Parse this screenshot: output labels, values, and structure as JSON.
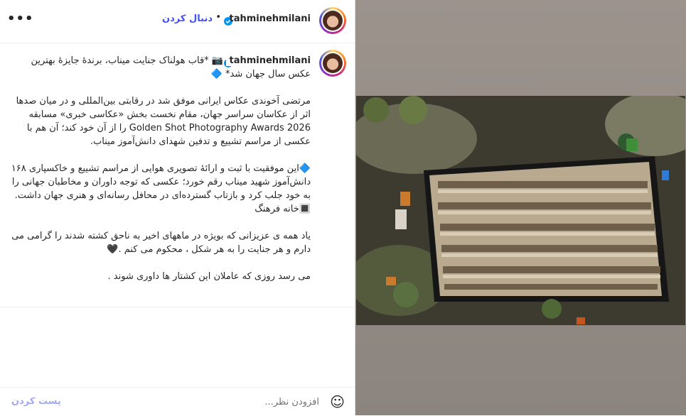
{
  "header": {
    "username": "tahminehmilani",
    "follow_label": "دنبال کردن",
    "separator": "•",
    "more_label": "•••"
  },
  "caption": {
    "username": "tahminehmilani",
    "paragraphs": [
      "*قاب هولناک جنایت میناب، برندهٔ جایزهٔ بهترین\nعکس سال جهان شد* 🔷",
      "مرتضی آخوندی عکاس ایرانی موفق شد در رقابتی بین‌المللی و در میان صدها اثر از عکاسان سراسر جهان، مقام نخست بخش «عکاسی خبری» مسابقه Golden Shot Photography Awards 2026 را از آن خود کند؛ آن هم با عکسی از مراسم تشییع و تدفین شهدای دانش‌آموز میناب.",
      "🔷این موفقیت با ثبت و ارائهٔ تصویری هوایی از مراسم تشییع و خاکسپاری ۱۶۸ دانش‌آموز شهید میناب رقم خورد؛ عکسی که توجه داوران و مخاطبان جهانی را به خود جلب کرد و بازتاب گسترده‌ای در محافل رسانه‌ای و هنری جهان داشت. 🔳خانه فرهنگ",
      "یاد همه ی عزیزانی که بویژه در ماههای اخیر به ناحق کشته شدند را گرامی می دارم و هر جنایت را به هر شکل ، محکوم می کنم .🖤",
      "می رسد روزی که عاملان این کشتار ها داوری شوند ."
    ]
  },
  "footer": {
    "comment_placeholder": "افزودن نظر...",
    "post_label": "پست کردن",
    "emoji_icon": "smiley-icon"
  },
  "colors": {
    "link_blue": "#4150f7",
    "post_disabled": "#a2a8f5",
    "verified_blue": "#0095f6"
  }
}
